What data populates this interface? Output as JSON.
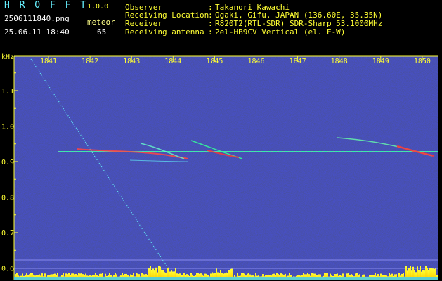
{
  "header": {
    "app_name": "H R O F F T",
    "version": "1.0.0",
    "filename": "2506111840.png",
    "datetime": "25.06.11 18:40",
    "meteor_label": "meteor",
    "meteor_count": "65"
  },
  "info": [
    {
      "key": "Observer",
      "sep": ":",
      "value": "Takanori Kawachi"
    },
    {
      "key": "Receiving Location",
      "sep": ":",
      "value": "Ogaki, Gifu, JAPAN (136.60E, 35.35N)"
    },
    {
      "key": "Receiver",
      "sep": ":",
      "value": "R820T2(RTL-SDR) SDR-Sharp 53.1000MHz"
    },
    {
      "key": "Receiving antenna",
      "sep": ":",
      "value": "2el-HB9CV Vertical (el. E-W)"
    }
  ],
  "spectrogram": {
    "y_unit": "kHz",
    "time_ticks": [
      "1841",
      "1842",
      "1843",
      "1844",
      "1845",
      "1846",
      "1847",
      "1848",
      "1849",
      "1850"
    ],
    "freq_ticks": [
      "1.1",
      "1.0",
      "0.9",
      "0.8",
      "0.7",
      "0.6"
    ],
    "carrier_khz": 0.925,
    "colors": {
      "text_yellow": "#ffff33",
      "text_cyan": "#66f0ff",
      "carrier": "#33ffaa",
      "background": "#000050"
    }
  }
}
